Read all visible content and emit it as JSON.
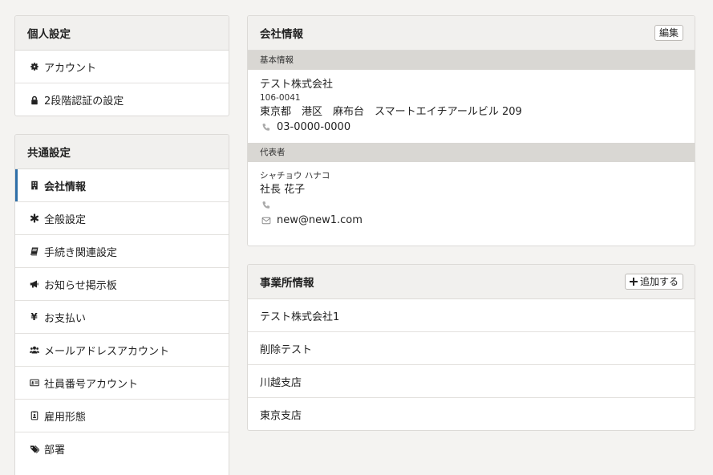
{
  "personal": {
    "title": "個人設定",
    "items": [
      {
        "label": "アカウント",
        "icon": "gear-icon"
      },
      {
        "label": "2段階認証の設定",
        "icon": "lock-icon"
      }
    ]
  },
  "common": {
    "title": "共通設定",
    "items": [
      {
        "label": "会社情報",
        "icon": "building-icon",
        "active": true
      },
      {
        "label": "全般設定",
        "icon": "asterisk-icon"
      },
      {
        "label": "手続き関連設定",
        "icon": "book-icon"
      },
      {
        "label": "お知らせ掲示板",
        "icon": "megaphone-icon"
      },
      {
        "label": "お支払い",
        "icon": "yen-icon"
      },
      {
        "label": "メールアドレスアカウント",
        "icon": "users-icon"
      },
      {
        "label": "社員番号アカウント",
        "icon": "id-card-icon"
      },
      {
        "label": "雇用形態",
        "icon": "badge-icon"
      },
      {
        "label": "部署",
        "icon": "tags-icon"
      }
    ]
  },
  "company": {
    "title": "会社情報",
    "edit_label": "編集",
    "basic_label": "基本情報",
    "name": "テスト株式会社",
    "postal": "106-0041",
    "address": "東京都　港区　麻布台　スマートエイチアールビル 209",
    "phone": "03-0000-0000",
    "rep_label": "代表者",
    "rep_kana": "シャチョウ ハナコ",
    "rep_name": "社長 花子",
    "rep_phone": "",
    "rep_email": "new@new1.com"
  },
  "offices": {
    "title": "事業所情報",
    "add_label": "追加する",
    "items": [
      "テスト株式会社1",
      "削除テスト",
      "川越支店",
      "東京支店"
    ]
  }
}
